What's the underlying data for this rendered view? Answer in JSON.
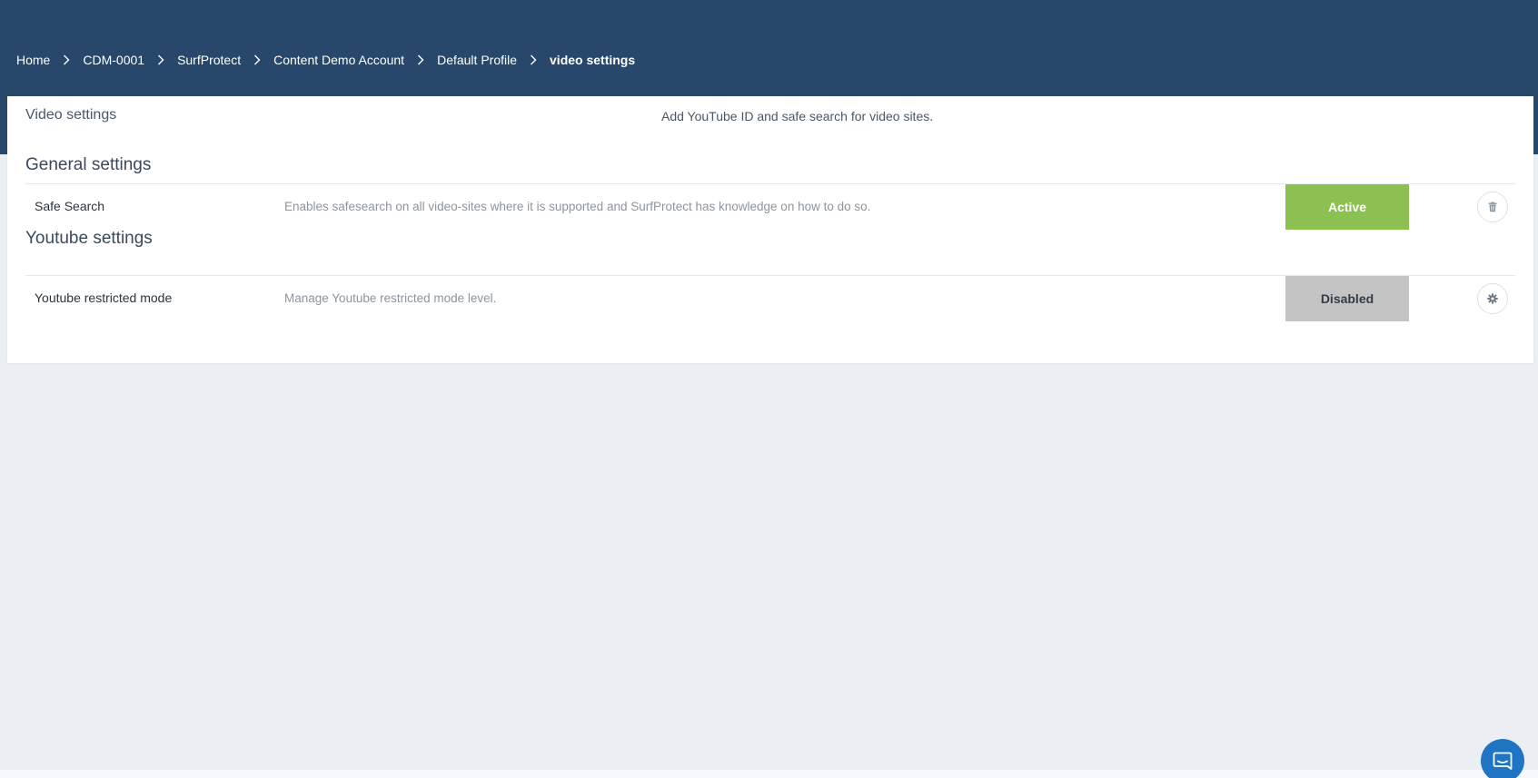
{
  "breadcrumb": {
    "items": [
      "Home",
      "CDM-0001",
      "SurfProtect",
      "Content Demo Account",
      "Default Profile"
    ],
    "current": "video settings"
  },
  "panel": {
    "title": "Video settings",
    "description": "Add YouTube ID and safe search for video sites."
  },
  "sections": [
    {
      "title": "General settings",
      "rows": [
        {
          "label": "Safe Search",
          "description": "Enables safesearch on all video-sites where it is supported and SurfProtect has knowledge on how to do so.",
          "status": "Active",
          "status_color": "#8cc152",
          "action_icon": "trash-icon"
        }
      ]
    },
    {
      "title": "Youtube settings",
      "rows": [
        {
          "label": "Youtube restricted mode",
          "description": "Manage Youtube restricted mode level.",
          "status": "Disabled",
          "status_color": "#c4c4c4",
          "action_icon": "gear-icon"
        }
      ]
    }
  ],
  "colors": {
    "header": "#27486b",
    "background": "#ebeff3",
    "chat_button": "#1f74c4"
  },
  "chat": {
    "icon": "chat-icon"
  }
}
